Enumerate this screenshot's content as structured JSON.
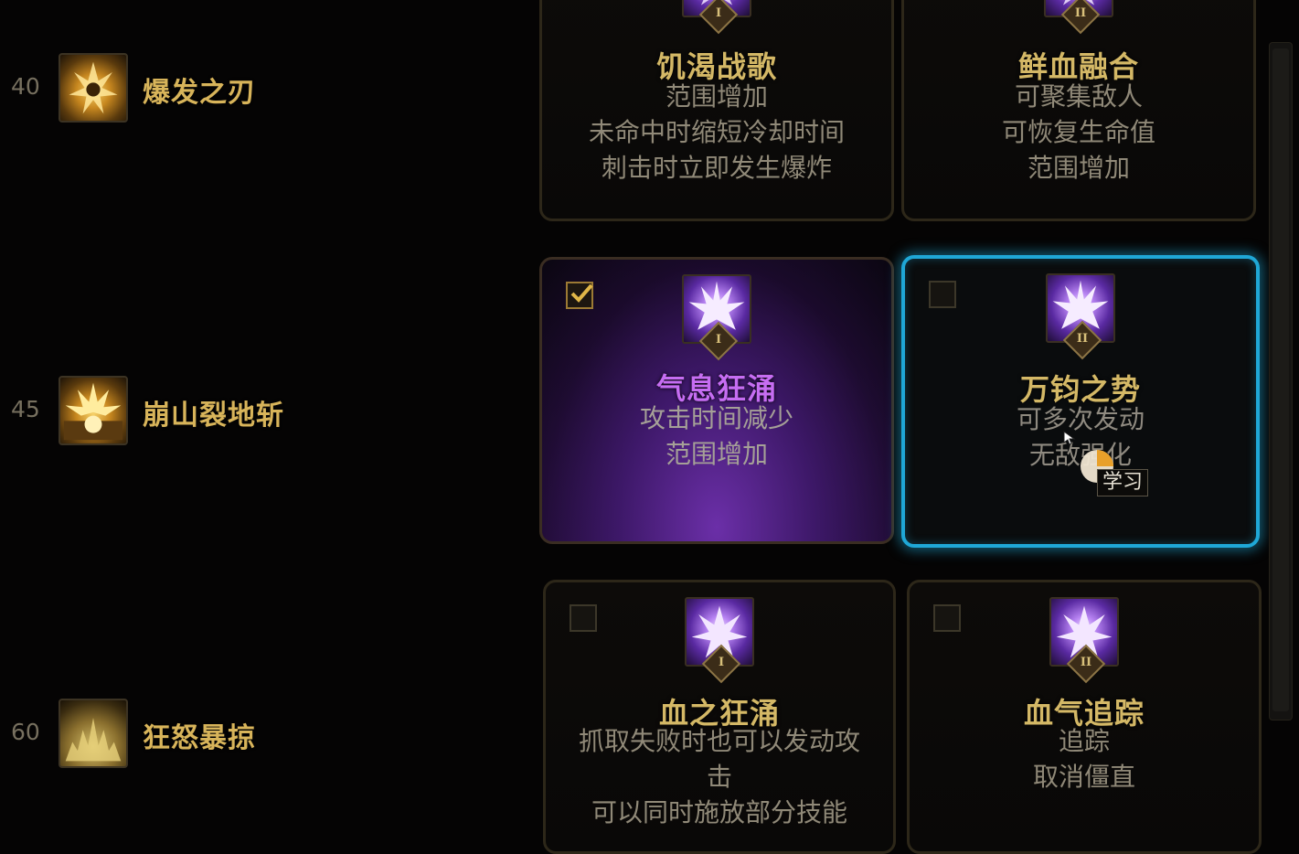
{
  "skills": [
    {
      "level": "40",
      "name": "爆发之刃",
      "icon": "blade-burst-icon"
    },
    {
      "level": "45",
      "name": "崩山裂地斩",
      "icon": "earth-splitter-icon"
    },
    {
      "level": "60",
      "name": "狂怒暴掠",
      "icon": "fury-storm-icon"
    }
  ],
  "cards": [
    {
      "numeral": "I",
      "title": "饥渴战歌",
      "desc": [
        "范围增加",
        "未命中时缩短冷却时间",
        "刺击时立即发生爆炸"
      ],
      "state": "normal",
      "checked": false
    },
    {
      "numeral": "II",
      "title": "鲜血融合",
      "desc": [
        "可聚集敌人",
        "可恢复生命值",
        "范围增加"
      ],
      "state": "normal",
      "checked": false
    },
    {
      "numeral": "I",
      "title": "气息狂涌",
      "desc": [
        "攻击时间减少",
        "范围增加"
      ],
      "state": "selected",
      "checked": true
    },
    {
      "numeral": "II",
      "title": "万钧之势",
      "desc": [
        "可多次发动",
        "无敌强化"
      ],
      "state": "hover",
      "checked": false
    },
    {
      "numeral": "I",
      "title": "血之狂涌",
      "desc": [
        "抓取失败时也可以发动攻",
        "击",
        "可以同时施放部分技能"
      ],
      "state": "normal",
      "checked": false
    },
    {
      "numeral": "II",
      "title": "血气追踪",
      "desc": [
        "追踪",
        "取消僵直"
      ],
      "state": "normal",
      "checked": false
    }
  ],
  "tooltip": {
    "label": "学习"
  },
  "colors": {
    "accent_gold": "#d4b866",
    "selected_purple": "#c66df2",
    "hover_cyan": "#1fa7d6"
  }
}
